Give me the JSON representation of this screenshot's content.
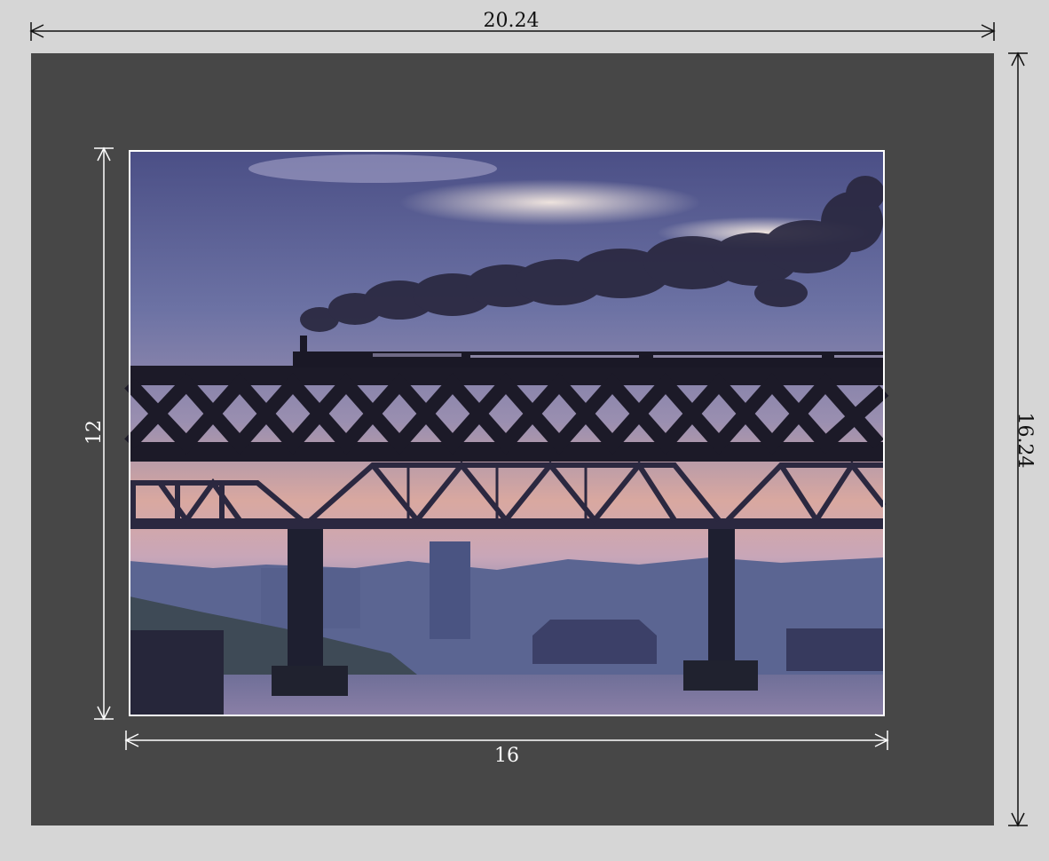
{
  "dimensions": {
    "outer_width": "20.24",
    "outer_height": "16.24",
    "inner_width": "16",
    "inner_height": "12"
  },
  "colors": {
    "page_background": "#d6d6d6",
    "mat": "#474747",
    "outer_dimension_line": "#111111",
    "inner_dimension_line": "#ffffff",
    "photo_border": "#ffffff"
  },
  "photo": {
    "subject": "steam-train-on-truss-bridge-at-dusk"
  }
}
